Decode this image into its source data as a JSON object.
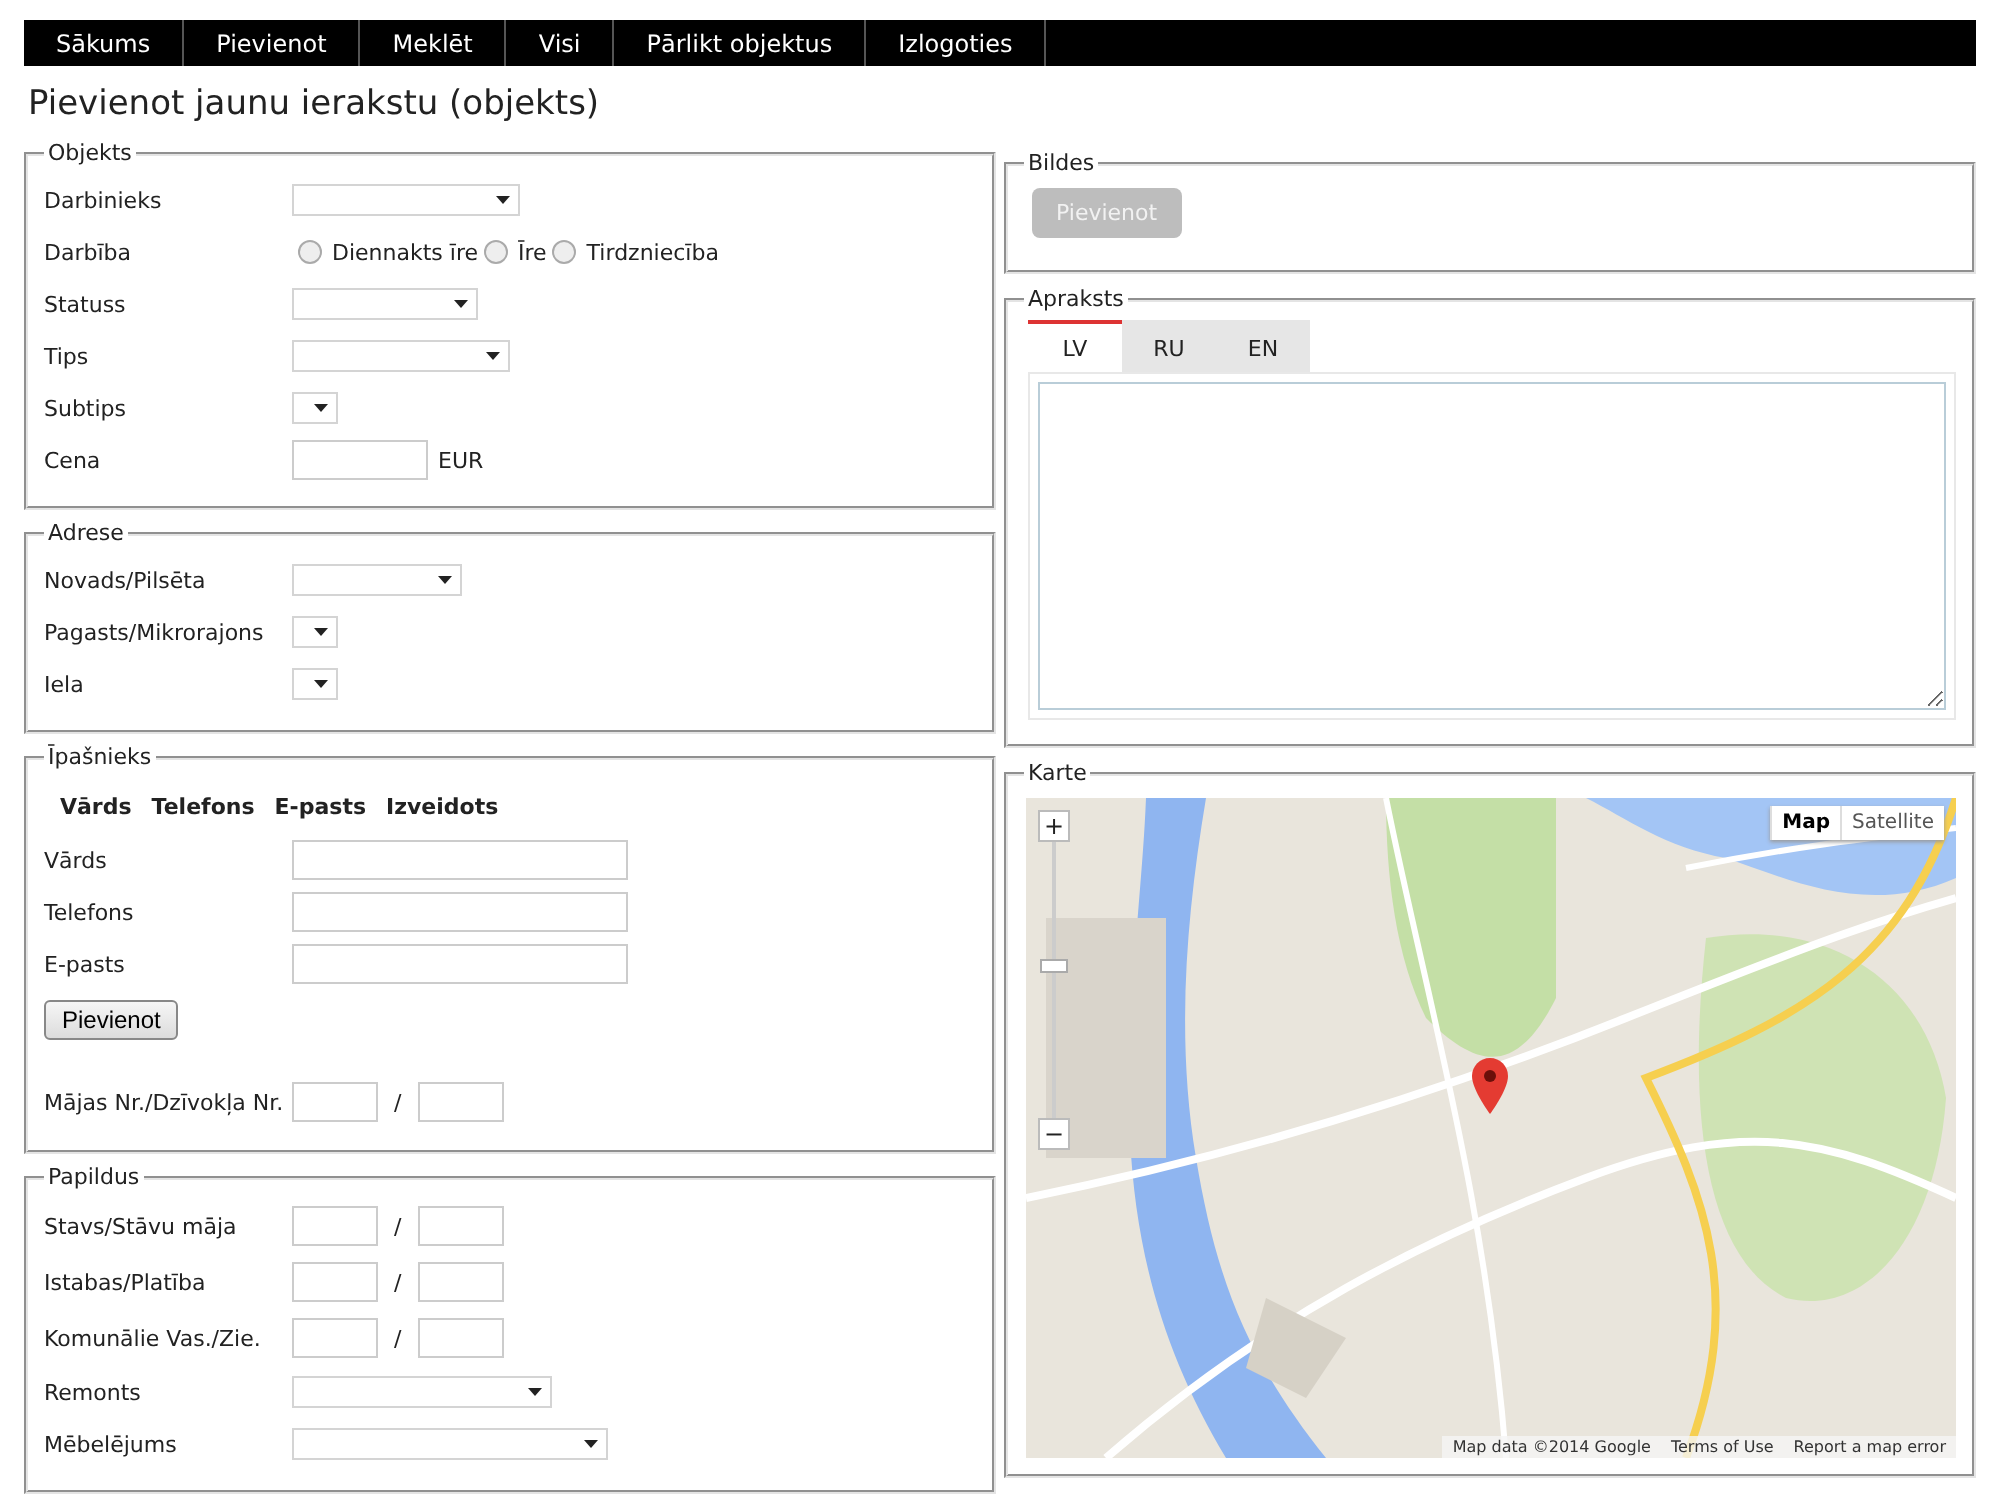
{
  "nav": [
    {
      "label": "Sākums"
    },
    {
      "label": "Pievienot"
    },
    {
      "label": "Meklēt"
    },
    {
      "label": "Visi"
    },
    {
      "label": "Pārlikt objektus"
    },
    {
      "label": "Izlogoties"
    }
  ],
  "title": "Pievienot jaunu ierakstu (objekts)",
  "left_sections": [
    {
      "legend": "Objekts",
      "rows": [
        {
          "kind": "select",
          "label": "Darbinieks"
        },
        {
          "kind": "radio",
          "label": "Darbība",
          "options": [
            {
              "label": "Diennakts īre",
              "selected": false
            },
            {
              "label": "Īre",
              "selected": false
            },
            {
              "label": "Tirdzniecība",
              "selected": false
            }
          ]
        },
        {
          "kind": "select",
          "label": "Statuss"
        },
        {
          "kind": "select",
          "label": "Tips"
        },
        {
          "kind": "select",
          "label": "Subtips"
        },
        {
          "kind": "text",
          "label": "Cena",
          "suffix": "EUR"
        }
      ]
    },
    {
      "legend": "Adrese",
      "rows": [
        {
          "kind": "select",
          "label": "Novads/Pilsēta"
        },
        {
          "kind": "select",
          "label": "Pagasts/Mikrorajons"
        },
        {
          "kind": "select",
          "label": "Iela"
        }
      ]
    },
    {
      "legend": "Īpašnieks",
      "columns": [
        "Vārds",
        "Telefons",
        "E-pasts",
        "Izveidots"
      ],
      "rows": [
        {
          "kind": "text",
          "label": "Vārds"
        },
        {
          "kind": "text",
          "label": "Telefons"
        },
        {
          "kind": "text",
          "label": "E-pasts"
        },
        {
          "kind": "button",
          "label": "Pievienot"
        },
        {
          "kind": "pair",
          "label": "Mājas Nr./Dzīvokļa Nr.",
          "separator": "/"
        }
      ]
    },
    {
      "legend": "Papildus",
      "rows": [
        {
          "kind": "pair",
          "label": "Stavs/Stāvu māja",
          "separator": "/"
        },
        {
          "kind": "pair",
          "label": "Istabas/Platība",
          "separator": "/"
        },
        {
          "kind": "pair",
          "label": "Komunālie Vas./Zie.",
          "separator": "/"
        },
        {
          "kind": "select",
          "label": "Remonts"
        },
        {
          "kind": "select",
          "label": "Mēbelējums"
        }
      ]
    }
  ],
  "images": {
    "legend": "Bildes",
    "button": {
      "label": "Pievienot",
      "disabled": true
    }
  },
  "description": {
    "legend": "Apraksts",
    "tabs": [
      {
        "label": "LV",
        "selected": true
      },
      {
        "label": "RU",
        "selected": false
      },
      {
        "label": "EN",
        "selected": false
      }
    ]
  },
  "map": {
    "legend": "Karte",
    "zoom_in": "+",
    "zoom_out": "−",
    "zoom_slider": {
      "level": 0.55
    },
    "types": [
      {
        "label": "Map",
        "selected": true
      },
      {
        "label": "Satellite",
        "selected": false
      }
    ],
    "attribution": "Map data ©2014 Google",
    "links": [
      "Terms of Use",
      "Report a map error"
    ]
  }
}
